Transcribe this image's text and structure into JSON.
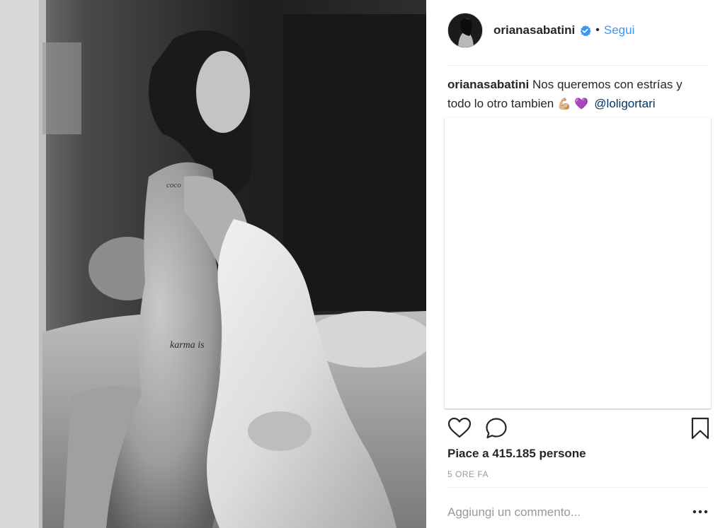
{
  "post": {
    "username": "orianasabatini",
    "follow_label": "Segui",
    "dot": "•",
    "caption": {
      "user": "orianasabatini",
      "text": " Nos queremos con estrías y todo lo otro tambien ",
      "emojis": "💪🏼 💜",
      "mention": "@loligortari"
    },
    "likes": "Piace a 415.185 persone",
    "time": "5 ORE FA",
    "comment": {
      "placeholder": "Aggiungi un commento...",
      "more_label": "•••"
    }
  },
  "photo": {
    "tattoos": [
      "coco",
      "karma is"
    ]
  },
  "colors": {
    "accent": "#3897f0",
    "mention": "#003569",
    "text": "#262626",
    "muted": "#999999"
  },
  "icons": {
    "verified": "verified-badge-icon",
    "like": "heart-outline-icon",
    "comment": "speech-bubble-icon",
    "save": "bookmark-icon",
    "more": "ellipsis-icon"
  }
}
